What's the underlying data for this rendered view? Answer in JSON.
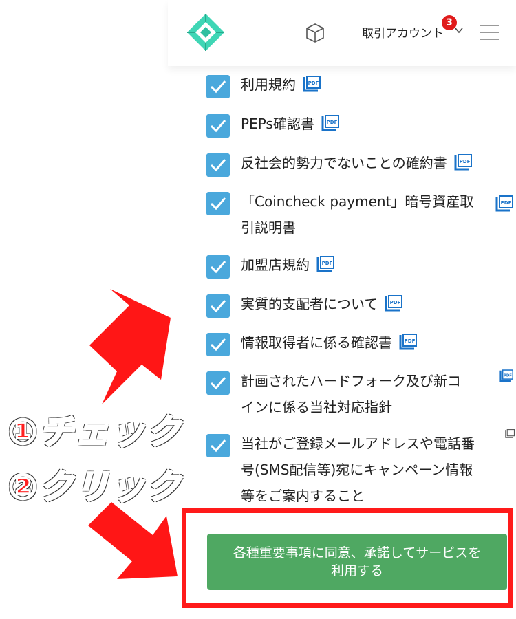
{
  "header": {
    "account_label": "取引アカウント",
    "badge_count": "3",
    "colors": {
      "logo": "#3fd6b5",
      "badge": "#e01b1b"
    }
  },
  "checklist": [
    {
      "label": "利用規約",
      "checked": true
    },
    {
      "label": "PEPs確認書",
      "checked": true
    },
    {
      "label": "反社会的勢力でないことの確約書",
      "checked": true
    },
    {
      "label": "「Coincheck payment」暗号資産取引説明書",
      "checked": true
    },
    {
      "label": "加盟店規約",
      "checked": true
    },
    {
      "label": "実質的支配者について",
      "checked": true
    },
    {
      "label": "情報取得者に係る確認書",
      "checked": true
    },
    {
      "label": "計画されたハードフォーク及び新コインに係る当社対応指針",
      "checked": true
    },
    {
      "label": "当社がご登録メールアドレスや電話番号(SMS配信等)宛にキャンペーン情報等をご案内すること",
      "checked": true
    }
  ],
  "checklist_display": {
    "item3_line1": "「Coincheck payment」暗号資産取",
    "item3_line2": "引説明書",
    "item7_line1": "計画されたハードフォーク及び新コ",
    "item7_line2": "インに係る当社対応指針",
    "item8_line1": "当社がご登録メールアドレスや電話番",
    "item8_line2": "号(SMS配信等)宛にキャンペーン情報",
    "item8_line3": "等をご案内すること"
  },
  "submit": {
    "label_line1": "各種重要事項に同意、承諾してサービスを",
    "label_line2": "利用する",
    "color": "#4fa862"
  },
  "annotations": {
    "step1": "①チェック",
    "step2": "②クリック",
    "color": "#ff2020"
  },
  "icons": [
    "logo-icon",
    "cube-icon",
    "chevron-down-icon",
    "menu-icon",
    "checkbox-check-icon",
    "pdf-icon"
  ]
}
